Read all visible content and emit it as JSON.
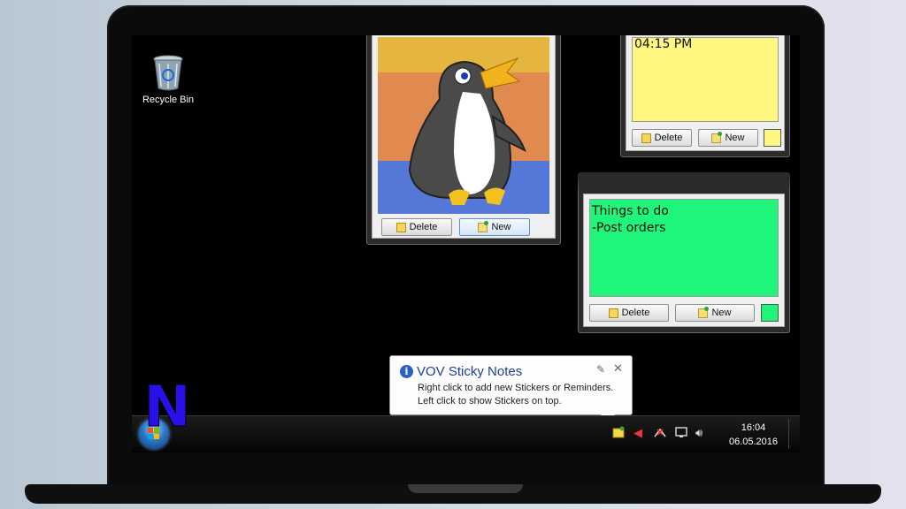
{
  "desktop": {
    "recycle_bin_label": "Recycle Bin"
  },
  "notes": {
    "penguin_note": {
      "delete_label": "Delete",
      "new_label": "New"
    },
    "yellow_note": {
      "time_text": "04:15 PM",
      "delete_label": "Delete",
      "new_label": "New",
      "color": "#fff77f"
    },
    "green_note": {
      "line1": "Things to do",
      "line2": "-Post orders",
      "delete_label": "Delete",
      "new_label": "New",
      "color": "#1ef57a"
    }
  },
  "balloon": {
    "title": "VOV  Sticky Notes",
    "line1": "Right click to add new Stickers or Reminders.",
    "line2": "Left click to show Stickers on top."
  },
  "taskbar": {
    "time": "16:04",
    "date": "06.05.2016",
    "tray_icons": [
      "sticky-notes-icon",
      "speaker-muted-icon",
      "network-icon",
      "action-center-icon",
      "volume-icon"
    ]
  },
  "colors": {
    "screen_bg": "#000000",
    "balloon_title": "#1e3f9a"
  }
}
